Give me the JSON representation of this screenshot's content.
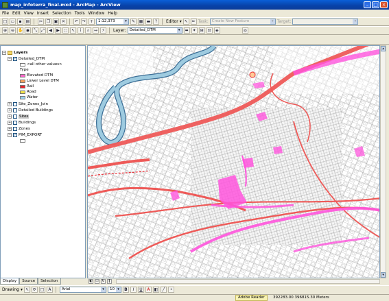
{
  "window": {
    "title": "map_infoterra_final.mxd - ArcMap - ArcView"
  },
  "menu": [
    "File",
    "Edit",
    "View",
    "Insert",
    "Selection",
    "Tools",
    "Window",
    "Help"
  ],
  "toolbar1": {
    "scale": "1:12,373",
    "editor_label": "Editor",
    "task_label": "Task:",
    "task_value": "Create New Feature",
    "target_label": "Target:"
  },
  "toolbar2": {
    "layer_label": "Layer:",
    "layer_value": "Detailed_DTM"
  },
  "toc": {
    "root_label": "Layers",
    "layer1": {
      "name": "Detailed_DTM",
      "legend": [
        {
          "label": "<all other values>",
          "color": "#ffffff"
        },
        {
          "label": "Type",
          "color": ""
        },
        {
          "label": "Elevated DTM",
          "color": "#ff66cc"
        },
        {
          "label": "Lower Level DTM",
          "color": "#f7a15c"
        },
        {
          "label": "Rail",
          "color": "#e8242d"
        },
        {
          "label": "Road",
          "color": "#f0e24a"
        },
        {
          "label": "Water",
          "color": "#9ed3ef"
        }
      ]
    },
    "layers": [
      {
        "name": "Site_Zones_Join",
        "checked": false
      },
      {
        "name": "Detailed Buildings",
        "checked": false
      },
      {
        "name": "Sites",
        "checked": false
      },
      {
        "name": "Buildings",
        "checked": false
      },
      {
        "name": "Zones",
        "checked": false
      },
      {
        "name": "PIM_EXPORT",
        "checked": true
      }
    ],
    "tabs": [
      "Display",
      "Source",
      "Selection"
    ]
  },
  "drawing": {
    "label": "Drawing",
    "font": "Arial",
    "size": "10",
    "bold": "B",
    "italic": "I",
    "underline": "U",
    "fontcolor": "A"
  },
  "status": {
    "taskbar_item": "Adobe Reader",
    "coordinates": "392283.00  396815.30 Meters"
  },
  "colors": {
    "road": "#ee5a58",
    "elevated": "#ff55dd",
    "water": "#9ecbe0",
    "linework": "#8a8a8a"
  }
}
